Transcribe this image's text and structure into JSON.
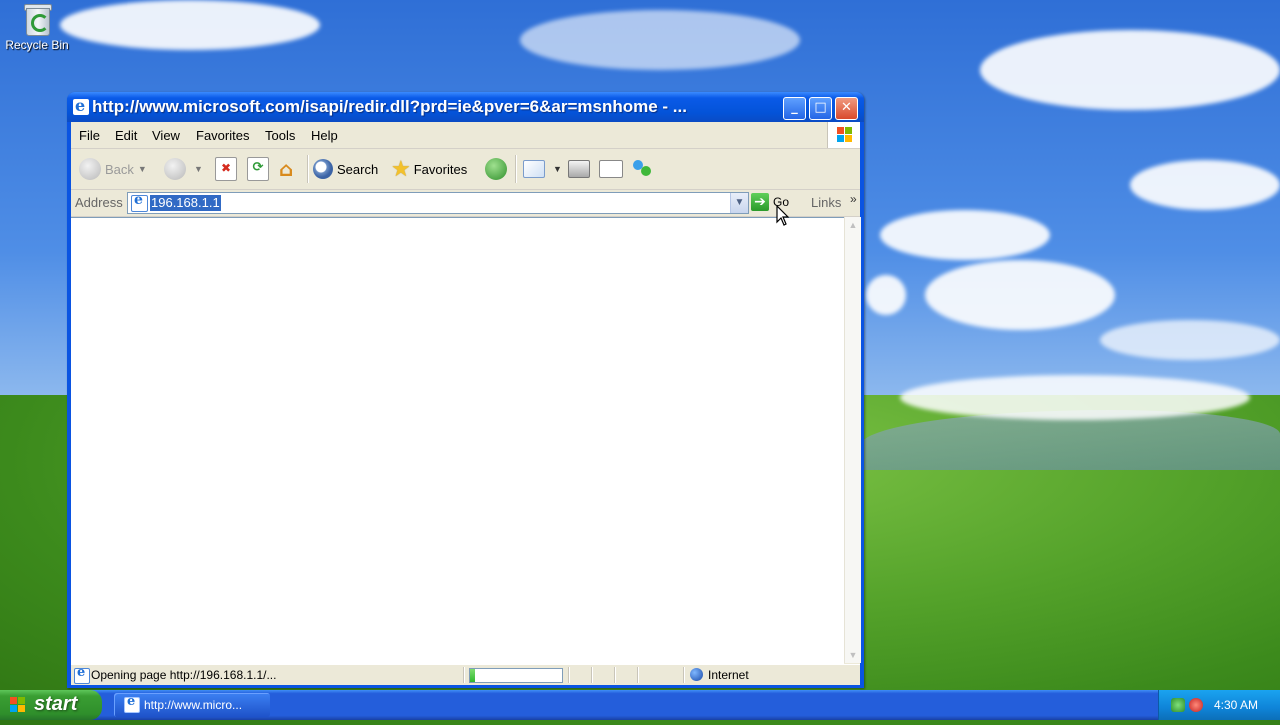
{
  "desktop": {
    "recycle_bin_label": "Recycle Bin"
  },
  "window": {
    "title": "http://www.microsoft.com/isapi/redir.dll?prd=ie&pver=6&ar=msnhome - ..."
  },
  "menu": {
    "items": [
      "File",
      "Edit",
      "View",
      "Favorites",
      "Tools",
      "Help"
    ]
  },
  "toolbar": {
    "back_label": "Back",
    "search_label": "Search",
    "favorites_label": "Favorites"
  },
  "address": {
    "label": "Address",
    "value": "196.168.1.1",
    "go_label": "Go",
    "links_label": "Links"
  },
  "status": {
    "text": "Opening page http://196.168.1.1/...",
    "zone": "Internet",
    "progress_fraction": 0.05
  },
  "taskbar": {
    "start_label": "start",
    "task_label": "http://www.micro...",
    "clock": "4:30 AM"
  },
  "colors": {
    "titlebar": "#0a54e2",
    "start_button": "#3a9e33",
    "taskbar": "#245edb",
    "selection": "#316ac5"
  }
}
